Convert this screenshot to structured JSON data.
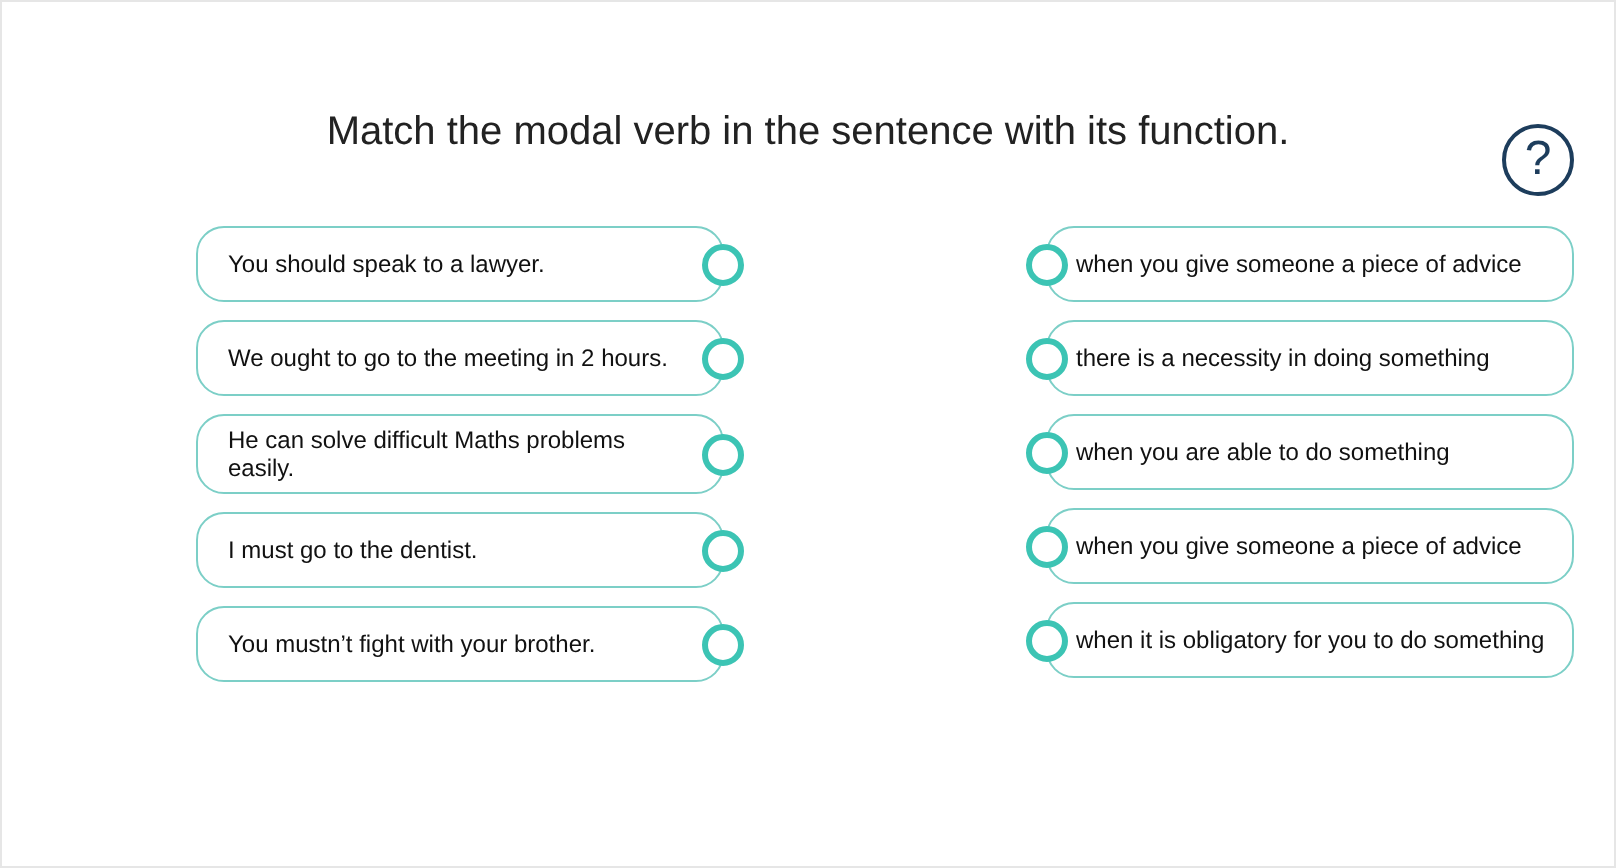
{
  "title": "Match the modal verb in the sentence with its function.",
  "help": {
    "symbol": "?"
  },
  "sentences": [
    {
      "text": "You should speak to a lawyer."
    },
    {
      "text": "We ought to go to the meeting in 2 hours."
    },
    {
      "text": "He can solve difficult Maths problems easily."
    },
    {
      "text": "I must go to the dentist."
    },
    {
      "text": "You mustn’t fight with your brother."
    }
  ],
  "functions": [
    {
      "text": "when you give someone a piece of advice"
    },
    {
      "text": "there is a necessity in doing something"
    },
    {
      "text": "when you are able to do something"
    },
    {
      "text": "when you give someone a piece of advice"
    },
    {
      "text": "when it is obligatory for you to do something"
    }
  ]
}
